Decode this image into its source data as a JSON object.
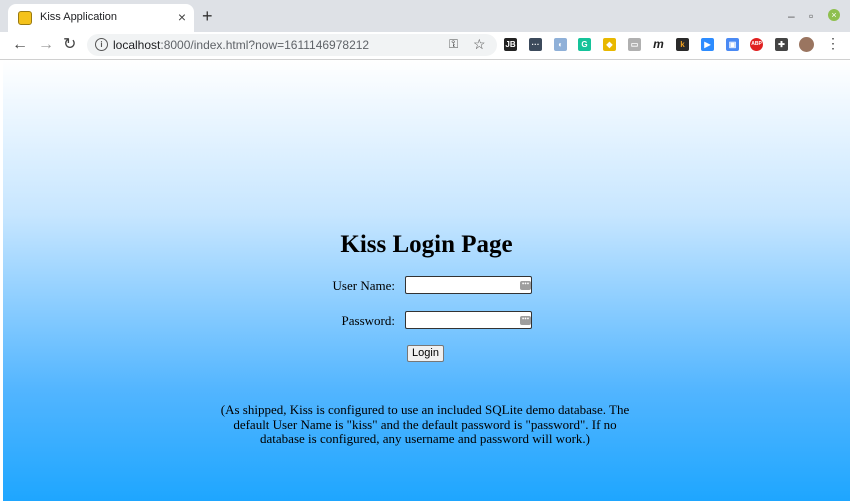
{
  "browser": {
    "tab_title": "Kiss Application",
    "tab_close": "×",
    "new_tab": "+",
    "url_host": "localhost",
    "url_rest": ":8000/index.html?now=1611146978212",
    "back": "←",
    "forward": "→",
    "reload": "↻",
    "star": "☆",
    "key": "⚿",
    "menu": "⋮",
    "minimize": "–",
    "restore": "▫",
    "close": "×",
    "extensions": [
      {
        "name": "jb-extension-icon",
        "label": "JB",
        "color": "#222222"
      },
      {
        "name": "dots-extension-icon",
        "label": "···",
        "color": "#3c4a5c"
      },
      {
        "name": "leaf-extension-icon",
        "label": "◐",
        "color": "#8fb0d8"
      },
      {
        "name": "grammarly-extension-icon",
        "label": "G",
        "color": "#15c39a"
      },
      {
        "name": "diamond-extension-icon",
        "label": "◆",
        "color": "#e8b800"
      },
      {
        "name": "clipboard-extension-icon",
        "label": "▭",
        "color": "#b0b0b0"
      },
      {
        "name": "m-extension-icon",
        "label": "m",
        "color": "#ffffff"
      },
      {
        "name": "k-extension-icon",
        "label": "k",
        "color": "#2a2a2a"
      },
      {
        "name": "zoom-extension-icon",
        "label": "▶",
        "color": "#2d8cff"
      },
      {
        "name": "tab-extension-icon",
        "label": "▣",
        "color": "#4a8af4"
      },
      {
        "name": "abp-extension-icon",
        "label": "ABP",
        "color": "#e02020"
      },
      {
        "name": "puzzle-extension-icon",
        "label": "✚",
        "color": "#444444"
      }
    ]
  },
  "login": {
    "title": "Kiss Login Page",
    "username_label": "User Name:",
    "username_value": "",
    "password_label": "Password:",
    "password_value": "",
    "field_icon": "•••",
    "button": "Login"
  },
  "note": "(As shipped, Kiss is configured to use an included SQLite demo database. The default User Name is \"kiss\" and the default password is \"password\". If no database is configured, any username and password will work.)"
}
